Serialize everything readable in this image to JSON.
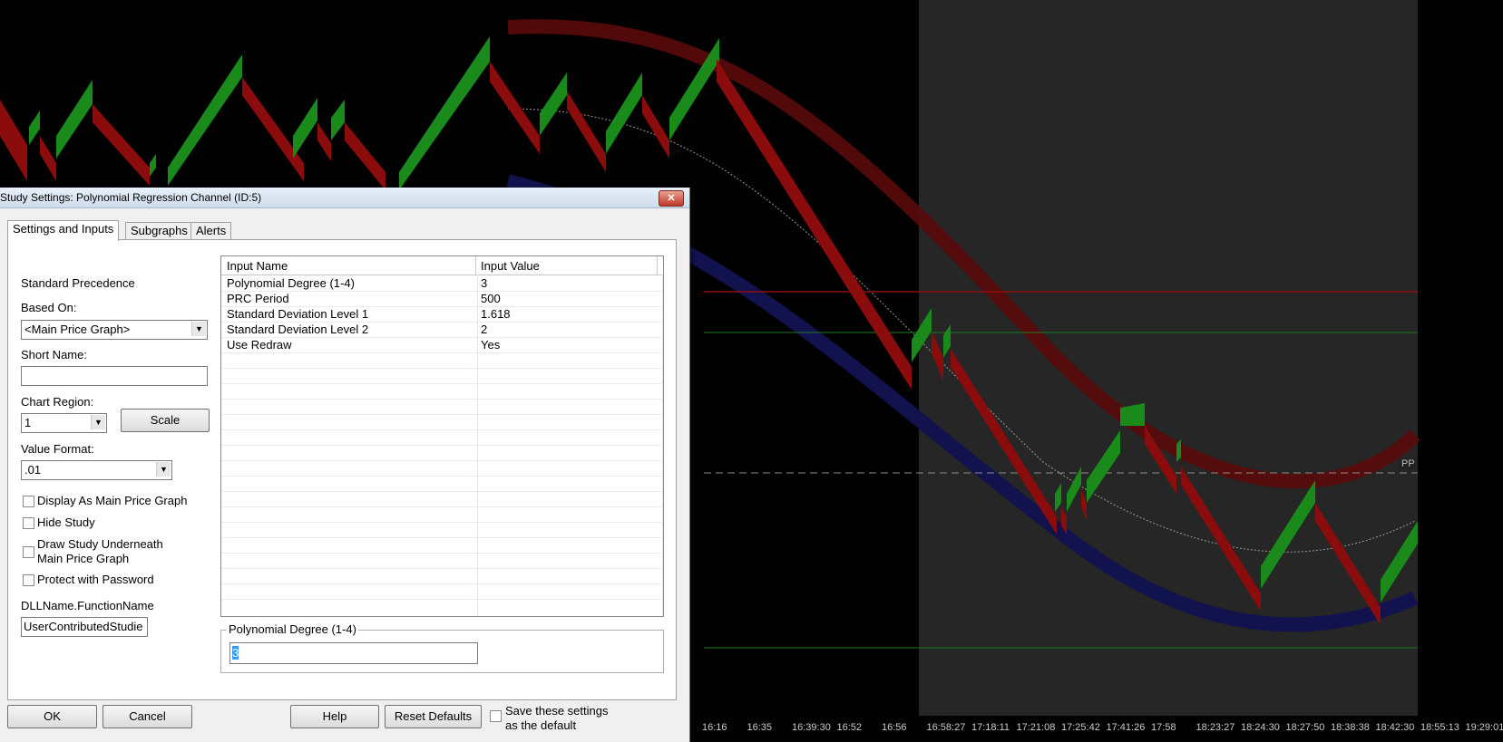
{
  "chart": {
    "pp_label": "PP",
    "time_labels": [
      "16:16",
      "16:35",
      "16:39:30",
      "16:52",
      "16:56",
      "16:58:27",
      "17:18:11",
      "17:21:08",
      "17:25:42",
      "17:41:26",
      "17:58",
      "18:23:27",
      "18:24:30",
      "18:27:50",
      "18:38:38",
      "18:42:30",
      "18:55:13",
      "19:29:01"
    ],
    "colors": {
      "up": "#1a8a1a",
      "down": "#8a0c0c",
      "upper_band": "#5a0a0a",
      "lower_band": "#12124e",
      "level_green": "#1f7a1f",
      "level_red": "#8a1010"
    }
  },
  "dialog": {
    "title": "Study Settings: Polynomial Regression Channel (ID:5)",
    "tabs": [
      "Settings and Inputs",
      "Subgraphs",
      "Alerts"
    ],
    "left": {
      "precedence": "Standard Precedence",
      "based_on_label": "Based On:",
      "based_on_value": "<Main Price Graph>",
      "short_name_label": "Short Name:",
      "short_name_value": "",
      "chart_region_label": "Chart Region:",
      "chart_region_value": "1",
      "scale_label": "Scale",
      "value_format_label": "Value Format:",
      "value_format_value": ".01",
      "checkboxes": [
        {
          "label": "Display As Main Price Graph",
          "checked": false
        },
        {
          "label": "Hide Study",
          "checked": false
        },
        {
          "label": "Draw Study Underneath",
          "label2": "Main Price Graph",
          "checked": false
        },
        {
          "label": "Protect with Password",
          "checked": false
        }
      ],
      "dll_label": "DLLName.FunctionName",
      "dll_value": "UserContributedStudie"
    },
    "grid": {
      "columns": [
        "Input Name",
        "Input Value"
      ],
      "rows": [
        {
          "name": "Polynomial Degree (1-4)",
          "value": "3"
        },
        {
          "name": "PRC Period",
          "value": "500"
        },
        {
          "name": "Standard Deviation Level 1",
          "value": "1.618"
        },
        {
          "name": "Standard Deviation Level 2",
          "value": "2"
        },
        {
          "name": "Use Redraw",
          "value": "Yes"
        }
      ]
    },
    "editor": {
      "legend": "Polynomial Degree (1-4)",
      "value": "3"
    },
    "buttons": {
      "ok": "OK",
      "cancel": "Cancel",
      "help": "Help",
      "reset": "Reset Defaults",
      "save_default_line1": "Save these settings",
      "save_default_line2": "as the default"
    }
  }
}
